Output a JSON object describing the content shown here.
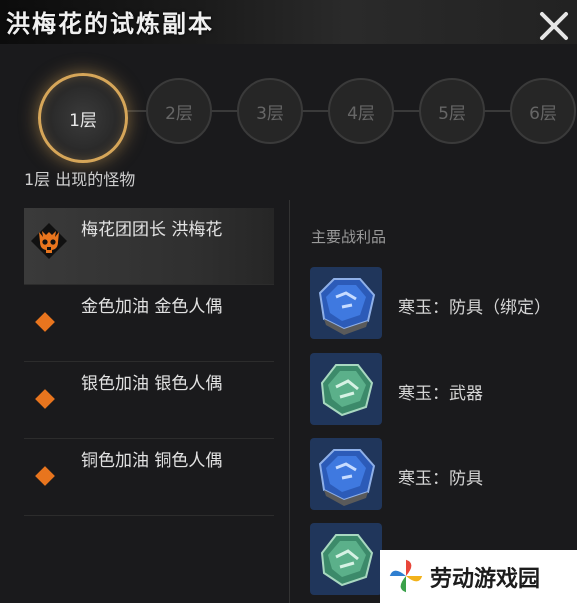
{
  "header": {
    "title": "洪梅花的试炼副本"
  },
  "floors": [
    "1层",
    "2层",
    "3层",
    "4层",
    "5层",
    "6层"
  ],
  "floor_caption": "1层 出现的怪物",
  "monsters": [
    {
      "name": "梅花团团长 洪梅花",
      "boss": true
    },
    {
      "name": "金色加油 金色人偶",
      "boss": false
    },
    {
      "name": "银色加油 银色人偶",
      "boss": false
    },
    {
      "name": "铜色加油 铜色人偶",
      "boss": false
    }
  ],
  "loot_header": "主要战利品",
  "loot": [
    {
      "label": "寒玉：防具（绑定）",
      "gem": "blue"
    },
    {
      "label": "寒玉：武器",
      "gem": "green"
    },
    {
      "label": "寒玉：防具",
      "gem": "blue"
    },
    {
      "label": "",
      "gem": "green"
    }
  ],
  "watermark": {
    "text": "劳动游戏园"
  },
  "colors": {
    "accent": "#d6a659",
    "diamond": "#e8751e",
    "gem_blue": "#2c5bb8",
    "gem_green": "#3c8a6a"
  }
}
